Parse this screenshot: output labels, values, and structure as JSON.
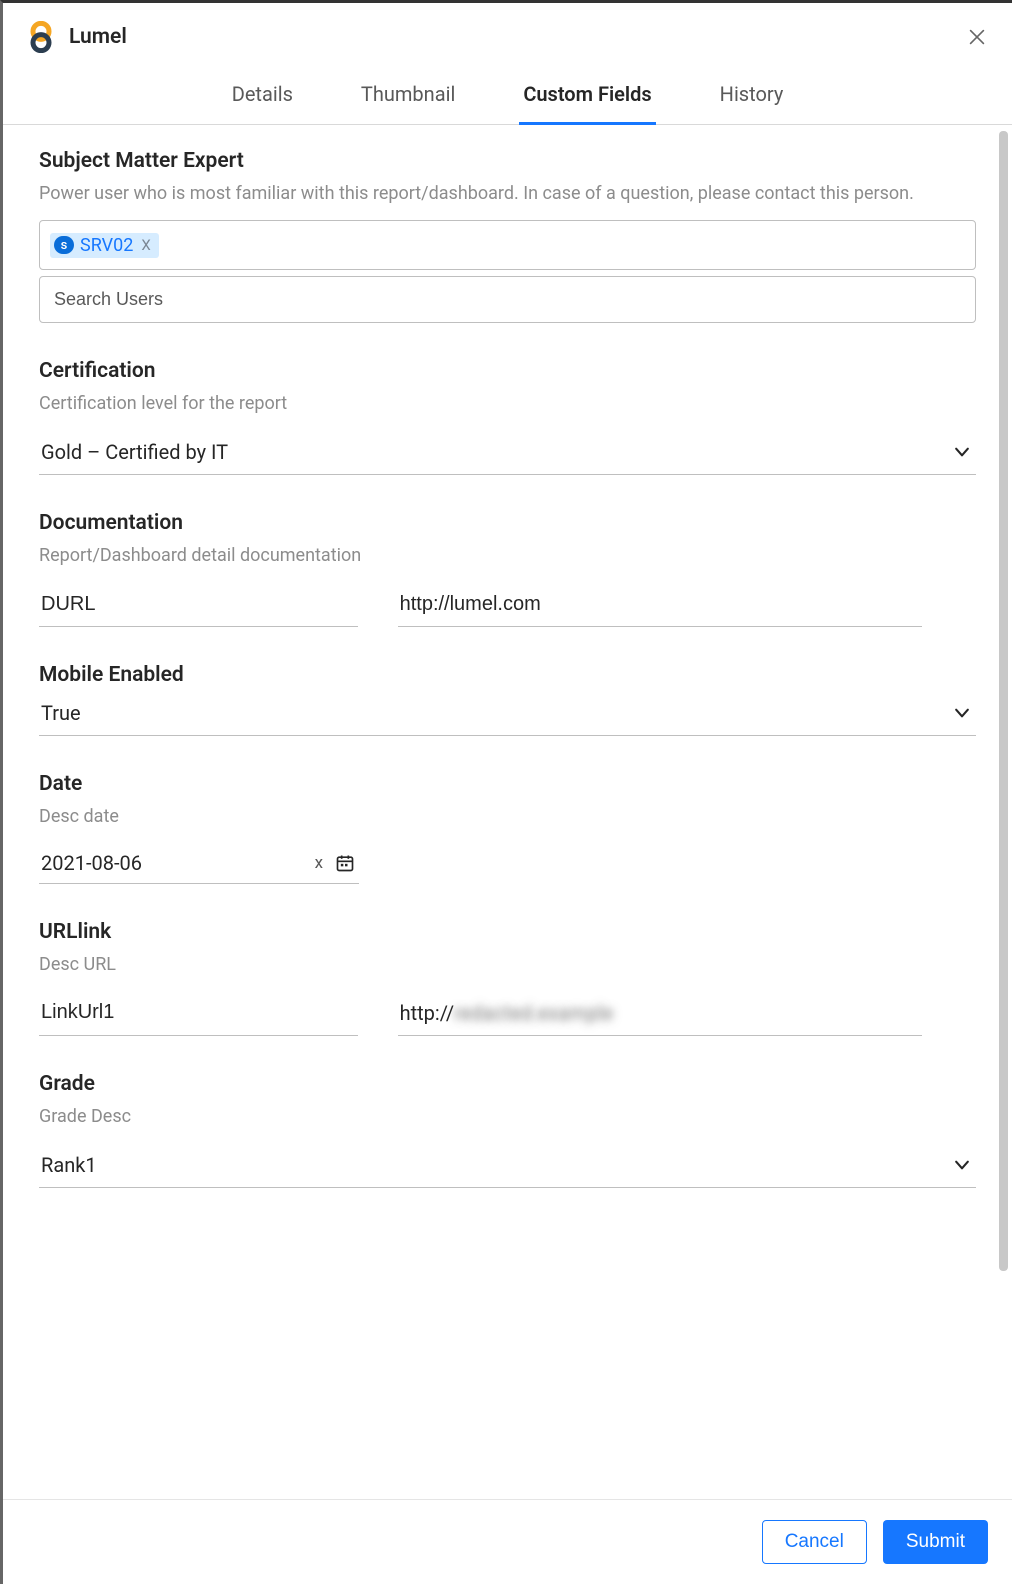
{
  "header": {
    "title": "Lumel"
  },
  "tabs": {
    "items": [
      {
        "label": "Details"
      },
      {
        "label": "Thumbnail"
      },
      {
        "label": "Custom Fields"
      },
      {
        "label": "History"
      }
    ],
    "active_index": 2
  },
  "sme": {
    "title": "Subject Matter Expert",
    "desc": "Power user who is most familiar with this report/dashboard. In case of a question, please contact this person.",
    "chip": {
      "avatar_letter": "s",
      "label": "SRV02",
      "remove": "X"
    },
    "search_placeholder": "Search Users"
  },
  "certification": {
    "title": "Certification",
    "desc": "Certification level for the report",
    "value": "Gold – Certified by IT"
  },
  "documentation": {
    "title": "Documentation",
    "desc": "Report/Dashboard detail documentation",
    "name_value": "DURL",
    "url_value": "http://lumel.com"
  },
  "mobile": {
    "title": "Mobile Enabled",
    "value": "True"
  },
  "date": {
    "title": "Date",
    "desc": "Desc date",
    "value": "2021-08-06",
    "clear": "x"
  },
  "urllink": {
    "title": "URLlink",
    "desc": "Desc URL",
    "name_value": "LinkUrl1",
    "url_prefix": "http://",
    "url_hidden": "redacted.example"
  },
  "grade": {
    "title": "Grade",
    "desc": "Grade Desc",
    "value": "Rank1"
  },
  "footer": {
    "cancel": "Cancel",
    "submit": "Submit"
  }
}
